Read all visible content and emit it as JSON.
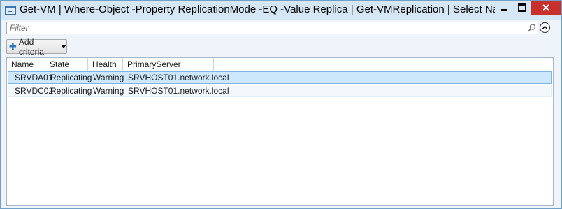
{
  "window": {
    "title": "Get-VM | Where-Object -Property ReplicationMode -EQ -Value Replica | Get-VMReplication | Select Name,State,Health..."
  },
  "filter": {
    "placeholder": "Filter",
    "value": ""
  },
  "toolbar": {
    "add_criteria_label": "Add criteria"
  },
  "grid": {
    "columns": [
      "Name",
      "State",
      "Health",
      "PrimaryServer"
    ],
    "rows": [
      {
        "name": "SRVDA01",
        "state": "Replicating",
        "health": "Warning",
        "server": "SRVHOST01.network.local"
      },
      {
        "name": "SRVDC02",
        "state": "Replicating",
        "health": "Warning",
        "server": "SRVHOST01.network.local"
      }
    ]
  },
  "icons": {
    "app": "powershell-window-icon",
    "search": "search-icon",
    "collapse": "chevron-up-circle-icon",
    "add": "plus-icon",
    "dropdown": "caret-down-icon",
    "minimize": "minimize-icon",
    "maximize": "maximize-icon",
    "close": "close-icon"
  },
  "colors": {
    "titlebar": "#d5e6f5",
    "close_button": "#c7302b",
    "selected_row": "#cde8fb",
    "selected_border": "#7eb4ea"
  }
}
